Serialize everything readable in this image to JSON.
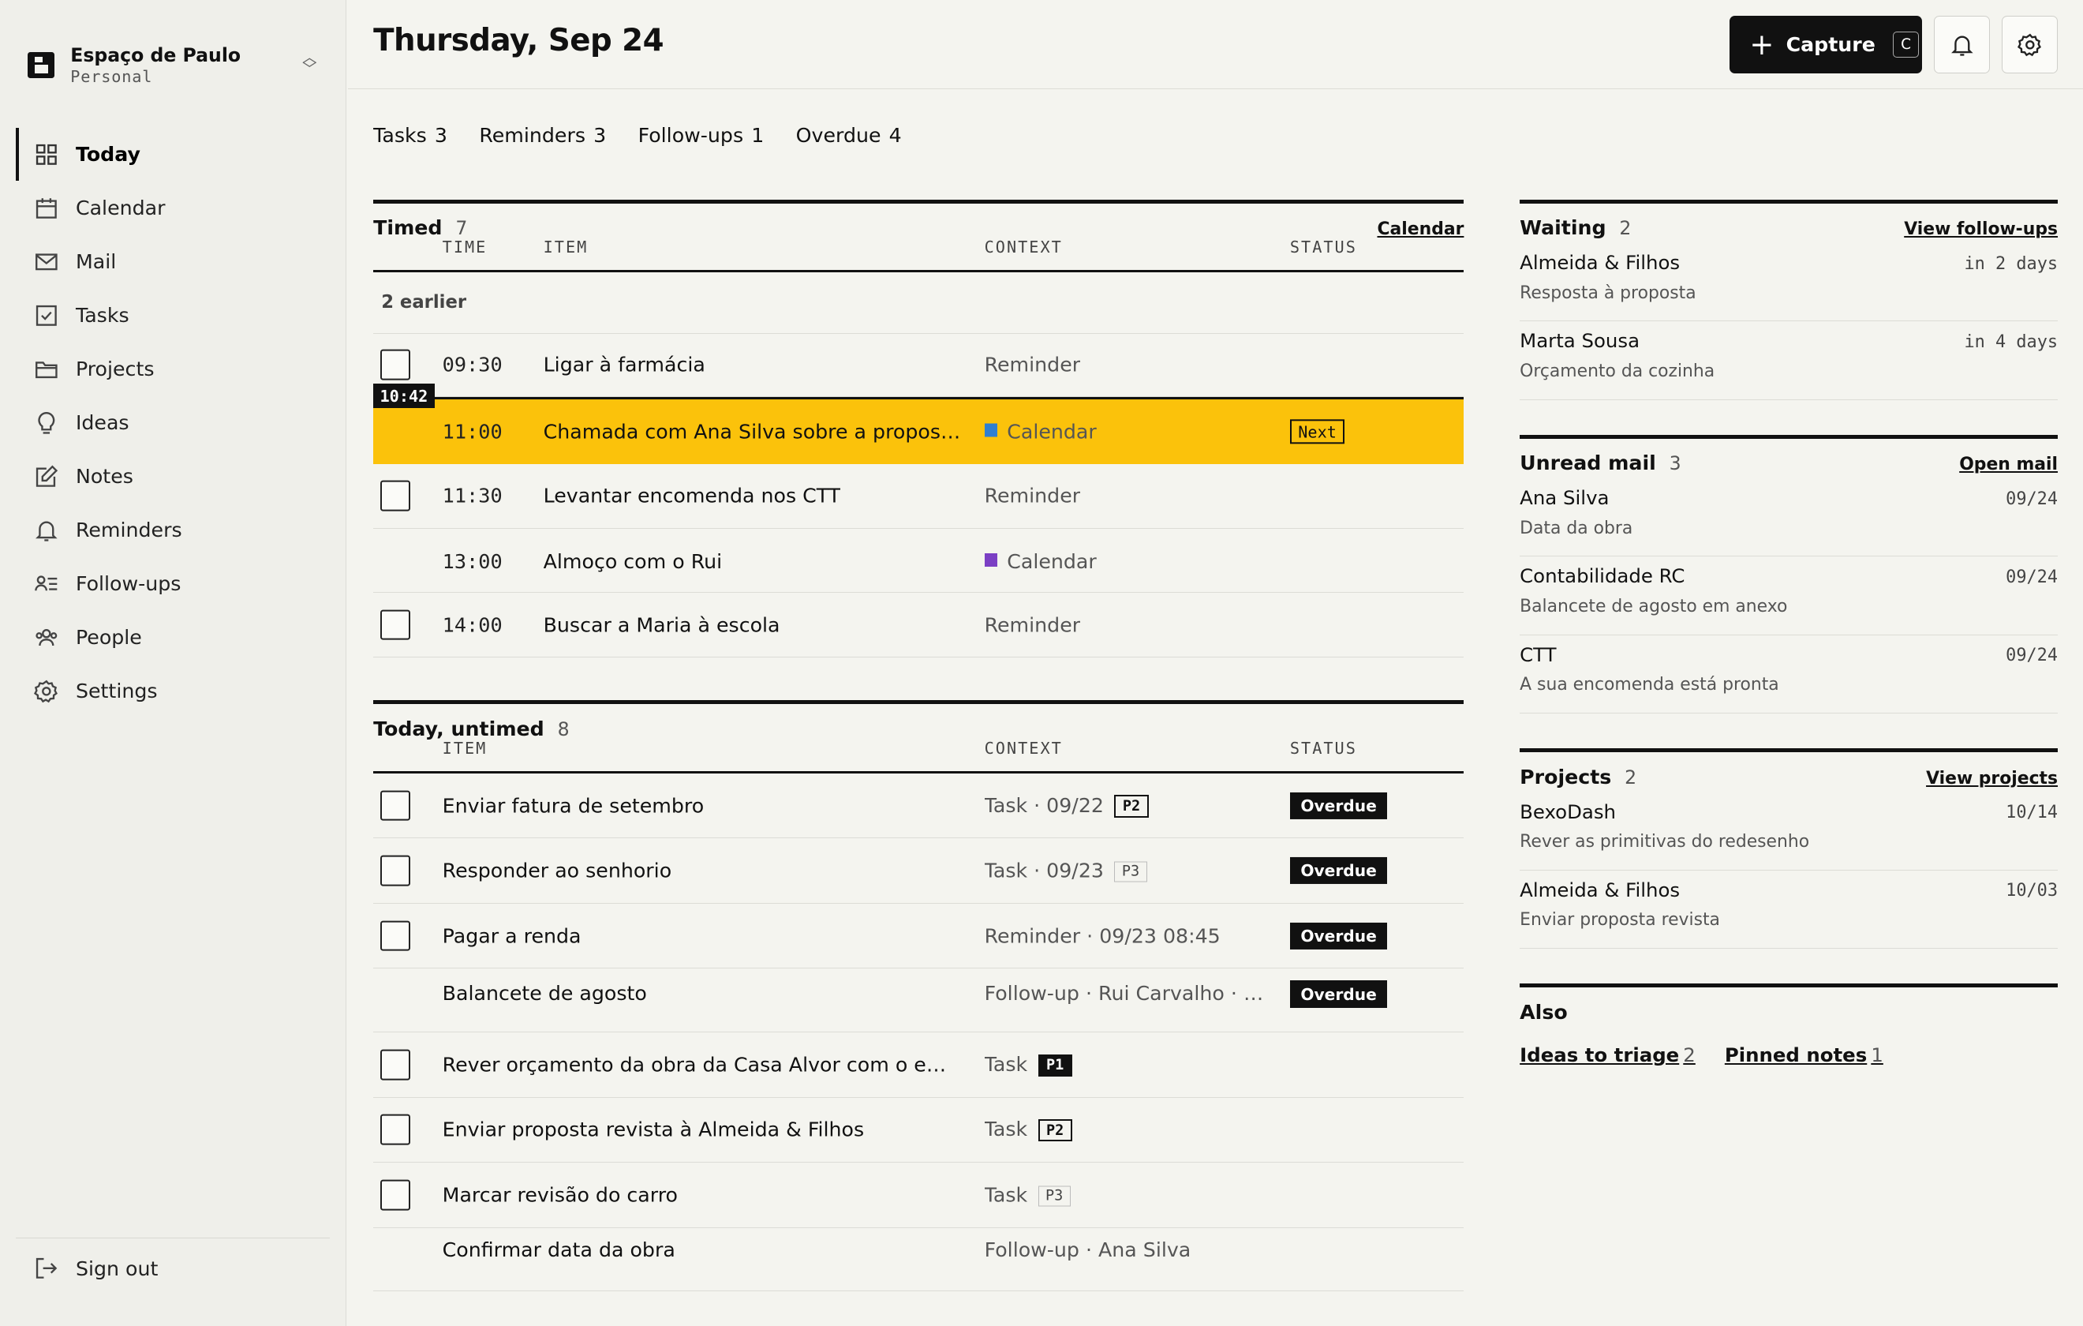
{
  "workspace": {
    "name": "Espaço de Paulo",
    "subtitle": "Personal"
  },
  "nav": [
    {
      "label": "Today",
      "icon": "grid-icon",
      "active": true
    },
    {
      "label": "Calendar",
      "icon": "calendar-icon"
    },
    {
      "label": "Mail",
      "icon": "mail-icon"
    },
    {
      "label": "Tasks",
      "icon": "checkbox-icon"
    },
    {
      "label": "Projects",
      "icon": "folder-icon"
    },
    {
      "label": "Ideas",
      "icon": "lightbulb-icon"
    },
    {
      "label": "Notes",
      "icon": "edit-icon"
    },
    {
      "label": "Reminders",
      "icon": "bell-icon"
    },
    {
      "label": "Follow-ups",
      "icon": "follow-list-icon"
    },
    {
      "label": "People",
      "icon": "people-icon"
    },
    {
      "label": "Settings",
      "icon": "gear-icon"
    }
  ],
  "signout": "Sign out",
  "header": {
    "title": "Thursday, Sep 24",
    "capture_label": "Capture",
    "capture_key": "C"
  },
  "summary": [
    {
      "label": "Tasks",
      "count": "3"
    },
    {
      "label": "Reminders",
      "count": "3"
    },
    {
      "label": "Follow-ups",
      "count": "1"
    },
    {
      "label": "Overdue",
      "count": "4"
    }
  ],
  "timed": {
    "title": "Timed",
    "count": "7",
    "link": "Calendar",
    "columns": {
      "time": "TIME",
      "item": "ITEM",
      "context": "CONTEXT",
      "status": "STATUS"
    },
    "earlier": "2 earlier",
    "now": "10:42",
    "rows": [
      {
        "time": "09:30",
        "item": "Ligar à farmácia",
        "context": "Reminder",
        "checkbox": true
      },
      {
        "time": "11:00",
        "item": "Chamada com Ana Silva sobre a proposta ...",
        "context": "Calendar",
        "swatch": "#2f7fd1",
        "status": "Next",
        "highlight": true
      },
      {
        "time": "11:30",
        "item": "Levantar encomenda nos CTT",
        "context": "Reminder",
        "checkbox": true
      },
      {
        "time": "13:00",
        "item": "Almoço com o Rui",
        "context": "Calendar",
        "swatch": "#7b3fc4"
      },
      {
        "time": "14:00",
        "item": "Buscar a Maria à escola",
        "context": "Reminder",
        "checkbox": true
      }
    ]
  },
  "untimed": {
    "title": "Today, untimed",
    "count": "8",
    "columns": {
      "item": "ITEM",
      "context": "CONTEXT",
      "status": "STATUS"
    },
    "rows": [
      {
        "item": "Enviar fatura de setembro",
        "context": "Task · 09/22",
        "prio": "P2",
        "status": "Overdue",
        "checkbox": true
      },
      {
        "item": "Responder ao senhorio",
        "context": "Task · 09/23",
        "prio": "P3",
        "status": "Overdue",
        "checkbox": true
      },
      {
        "item": "Pagar a renda",
        "context": "Reminder · 09/23 08:45",
        "status": "Overdue",
        "checkbox": true
      },
      {
        "item": "Balancete de agosto",
        "context": "Follow-up · Rui Carvalho · 09...",
        "status": "Overdue"
      },
      {
        "item": "Rever orçamento da obra da Casa Alvor com o empr...",
        "context": "Task",
        "prio": "P1",
        "checkbox": true
      },
      {
        "item": "Enviar proposta revista à Almeida & Filhos",
        "context": "Task",
        "prio": "P2",
        "checkbox": true
      },
      {
        "item": "Marcar revisão do carro",
        "context": "Task",
        "prio": "P3",
        "checkbox": true
      },
      {
        "item": "Confirmar data da obra",
        "context": "Follow-up · Ana Silva"
      }
    ]
  },
  "waiting": {
    "title": "Waiting",
    "count": "2",
    "link": "View follow-ups",
    "items": [
      {
        "title": "Almeida & Filhos",
        "sub": "Resposta à proposta",
        "meta": "in 2 days"
      },
      {
        "title": "Marta Sousa",
        "sub": "Orçamento da cozinha",
        "meta": "in 4 days"
      }
    ]
  },
  "mail": {
    "title": "Unread mail",
    "count": "3",
    "link": "Open mail",
    "items": [
      {
        "title": "Ana Silva",
        "sub": "Data da obra",
        "meta": "09/24"
      },
      {
        "title": "Contabilidade RC",
        "sub": "Balancete de agosto em anexo",
        "meta": "09/24"
      },
      {
        "title": "CTT",
        "sub": "A sua encomenda está pronta",
        "meta": "09/24"
      }
    ]
  },
  "projects": {
    "title": "Projects",
    "count": "2",
    "link": "View projects",
    "items": [
      {
        "title": "BexoDash",
        "sub": "Rever as primitivas do redesenho",
        "meta": "10/14"
      },
      {
        "title": "Almeida & Filhos",
        "sub": "Enviar proposta revista",
        "meta": "10/03"
      }
    ]
  },
  "also": {
    "title": "Also",
    "links": [
      {
        "label": "Ideas to triage",
        "count": "2"
      },
      {
        "label": "Pinned notes",
        "count": "1"
      }
    ]
  }
}
